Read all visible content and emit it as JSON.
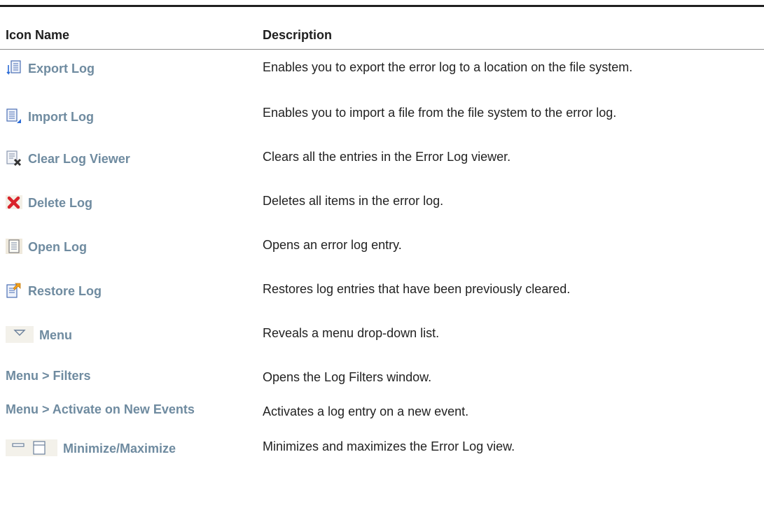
{
  "header": {
    "col_name": "Icon Name",
    "col_description": "Description"
  },
  "rows": [
    {
      "icon": "export-log-icon",
      "name": "Export Log",
      "description": "Enables you to export the error log to a location on the file system."
    },
    {
      "icon": "import-log-icon",
      "name": "Import Log",
      "description": "Enables you to import a file from the file system to the error log."
    },
    {
      "icon": "clear-log-viewer-icon",
      "name": "Clear Log Viewer",
      "description": "Clears all the entries in the Error Log viewer."
    },
    {
      "icon": "delete-log-icon",
      "name": "Delete Log",
      "description": "Deletes all items in the error log."
    },
    {
      "icon": "open-log-icon",
      "name": "Open Log",
      "description": "Opens an error log entry."
    },
    {
      "icon": "restore-log-icon",
      "name": "Restore Log",
      "description": "Restores log entries that have been previously cleared."
    },
    {
      "icon": "menu-dropdown-icon",
      "name": "Menu",
      "description": "Reveals a menu drop-down list."
    },
    {
      "icon": "",
      "name": "Menu > Filters",
      "description": "Opens the Log Filters window."
    },
    {
      "icon": "",
      "name": "Menu > Activate on New Events",
      "description": "Activates a log entry on a new event."
    },
    {
      "icon": "minimize-maximize-icon",
      "name": "Minimize/Maximize",
      "description": "Minimizes and maximizes the Error Log view."
    }
  ]
}
